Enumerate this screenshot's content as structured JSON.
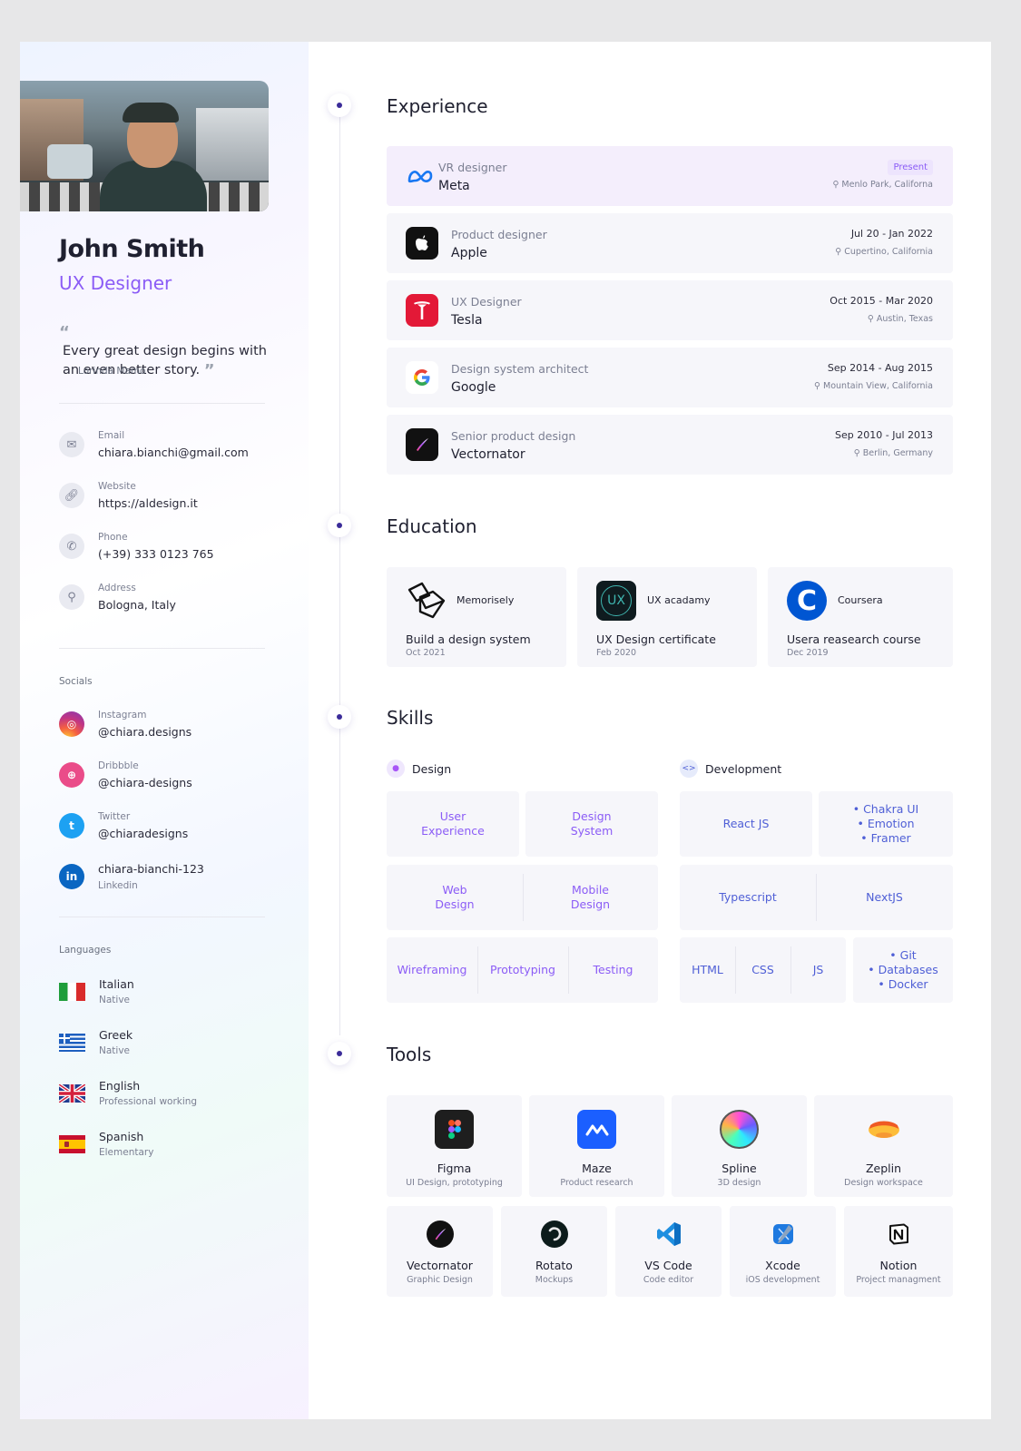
{
  "profile": {
    "name": "John Smith",
    "role": "UX Designer",
    "quote_open": "“",
    "quote_text": "Every great design begins with an even better story.",
    "quote_close": "”",
    "quote_author": "Lorinda Mamo"
  },
  "contacts": [
    {
      "label": "Email",
      "value": "chiara.bianchi@gmail.com",
      "icon": "mail-icon"
    },
    {
      "label": "Website",
      "value": "https://aldesign.it",
      "icon": "link-icon"
    },
    {
      "label": "Phone",
      "value": "(+39) 333 0123 765",
      "icon": "phone-icon"
    },
    {
      "label": "Address",
      "value": "Bologna, Italy",
      "icon": "location-pin-icon"
    }
  ],
  "socials": {
    "heading": "Socials",
    "items": [
      {
        "label": "Instagram",
        "value": "@chiara.designs",
        "color": "#e4405f"
      },
      {
        "label": "Dribbble",
        "value": "@chiara-designs",
        "color": "#ea4c89"
      },
      {
        "label": "Twitter",
        "value": "@chiaradesigns",
        "color": "#1da1f2"
      },
      {
        "label": "Linkedin",
        "value": "chiara-bianchi-123",
        "color": "#0a66c2"
      }
    ]
  },
  "languages": {
    "heading": "Languages",
    "items": [
      {
        "name": "Italian",
        "level": "Native"
      },
      {
        "name": "Greek",
        "level": "Native"
      },
      {
        "name": "English",
        "level": "Professional working"
      },
      {
        "name": "Spanish",
        "level": "Elementary"
      }
    ]
  },
  "experience": {
    "heading": "Experience",
    "present_label": "Present",
    "items": [
      {
        "title": "VR designer",
        "company": "Meta",
        "location": "Menlo Park, Californa",
        "logo": "meta-logo"
      },
      {
        "title": "Product designer",
        "company": "Apple",
        "date": "Jul 20 - Jan 2022",
        "location": "Cupertino, California",
        "logo": "apple-logo"
      },
      {
        "title": "UX Designer",
        "company": "Tesla",
        "date": "Oct 2015 - Mar 2020",
        "location": "Austin, Texas",
        "logo": "tesla-logo"
      },
      {
        "title": "Design system architect",
        "company": "Google",
        "date": "Sep 2014 - Aug 2015",
        "location": "Mountain View, California",
        "logo": "google-logo"
      },
      {
        "title": "Senior product design",
        "company": "Vectornator",
        "date": "Sep 2010 - Jul 2013",
        "location": "Berlin, Germany",
        "logo": "vectornator-logo"
      }
    ]
  },
  "education": {
    "heading": "Education",
    "items": [
      {
        "school": "Memorisely",
        "course": "Build a design system",
        "date": "Oct 2021"
      },
      {
        "school": "UX acadamy",
        "course": "UX Design certificate",
        "date": "Feb 2020",
        "logo_text": "UX"
      },
      {
        "school": "Coursera",
        "course": "Usera reasearch course",
        "date": "Dec 2019",
        "logo_text": "C"
      }
    ]
  },
  "skills": {
    "heading": "Skills",
    "design_label": "Design",
    "development_label": "Development",
    "design": {
      "user_experience": "User Experience",
      "design_system": "Design System",
      "web_design": "Web Design",
      "mobile_design": "Mobile Design",
      "wireframing": "Wireframing",
      "prototyping": "Prototyping",
      "testing": "Testing"
    },
    "development": {
      "react": "React JS",
      "chakra": "• Chakra UI",
      "emotion": "• Emotion",
      "framer": "• Framer",
      "typescript": "Typescript",
      "nextjs": "NextJS",
      "html": "HTML",
      "css": "CSS",
      "js": "JS",
      "git": "• Git",
      "databases": "• Databases",
      "docker": "• Docker"
    }
  },
  "tools": {
    "heading": "Tools",
    "items": [
      {
        "name": "Figma",
        "desc": "UI Design, prototyping"
      },
      {
        "name": "Maze",
        "desc": "Product research"
      },
      {
        "name": "Spline",
        "desc": "3D design"
      },
      {
        "name": "Zeplin",
        "desc": "Design workspace"
      },
      {
        "name": "Vectornator",
        "desc": "Graphic Design"
      },
      {
        "name": "Rotato",
        "desc": "Mockups"
      },
      {
        "name": "VS Code",
        "desc": "Code editor"
      },
      {
        "name": "Xcode",
        "desc": "iOS development"
      },
      {
        "name": "Notion",
        "desc": "Project managment"
      }
    ]
  },
  "colors": {
    "accent": "#8b5cf6",
    "timeline_dot": "#3b2c99",
    "card_bg": "#f6f6fa"
  }
}
